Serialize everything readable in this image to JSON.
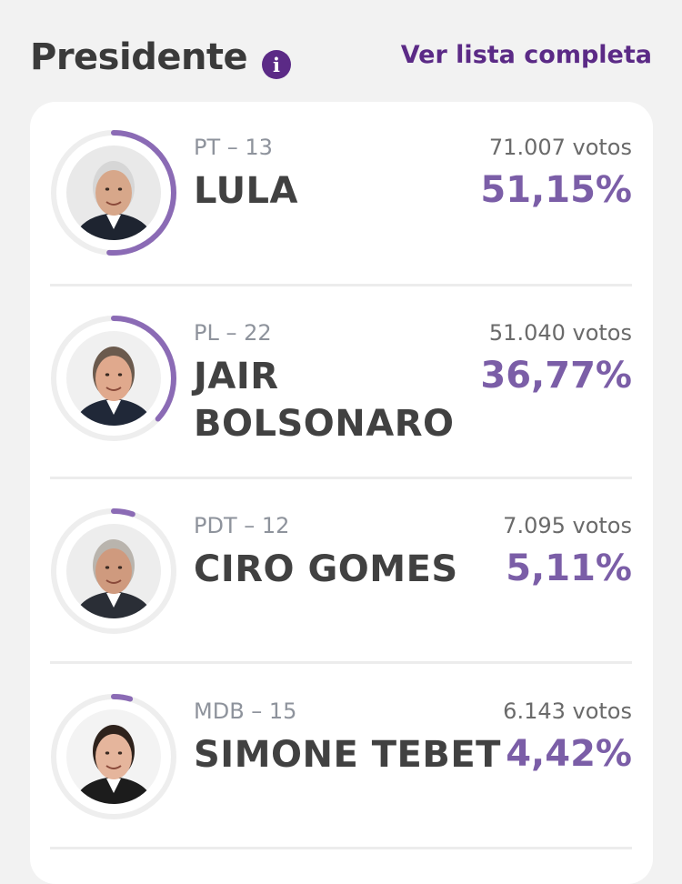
{
  "header": {
    "title": "Presidente",
    "info_icon": "info-icon",
    "view_all": "Ver lista completa"
  },
  "colors": {
    "accent": "#5b2a86",
    "percent": "#7b5ea7",
    "ring": "#8b6bb5",
    "ring_track": "#eeeeee"
  },
  "candidates": [
    {
      "party": "PT – 13",
      "name": "LULA",
      "votes": "71.007 votos",
      "percent": "51,15%",
      "share": 0.5115,
      "photo_bg": "#e9e9e9",
      "skin": "#d7a78a",
      "hair": "#d6d6d6",
      "suit": "#1e2430"
    },
    {
      "party": "PL – 22",
      "name_line1": "JAIR",
      "name_line2": "BOLSONARO",
      "votes": "51.040 votos",
      "percent": "36,77%",
      "share": 0.3677,
      "photo_bg": "#f0f0f0",
      "skin": "#e0a98d",
      "hair": "#6b5a4d",
      "suit": "#202838"
    },
    {
      "party": "PDT – 12",
      "name": "CIRO GOMES",
      "votes": "7.095 votos",
      "percent": "5,11%",
      "share": 0.0511,
      "photo_bg": "#ededed",
      "skin": "#cf9a7e",
      "hair": "#b9b4ad",
      "suit": "#2a2e36"
    },
    {
      "party": "MDB – 15",
      "name": "SIMONE TEBET",
      "votes": "6.143 votos",
      "percent": "4,42%",
      "share": 0.0442,
      "photo_bg": "#f3f3f3",
      "skin": "#e5b59c",
      "hair": "#2e221c",
      "suit": "#1c1c1c"
    }
  ]
}
